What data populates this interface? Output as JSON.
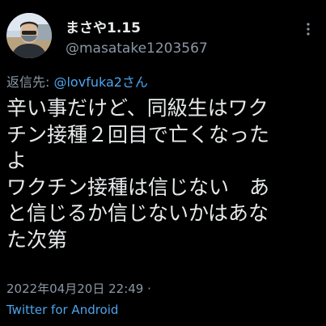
{
  "author": {
    "name": "まさや1.15",
    "handle": "@masatake1203567",
    "avatar": "avatar-photo"
  },
  "reply": {
    "label": "返信先: ",
    "target": "@lovfuka2さん"
  },
  "body": {
    "lines": [
      "辛い事だけど、同級生はワク",
      "チン接種２回目で亡くなった",
      "よ",
      "ワクチン接種は信じない　あ",
      "と信じるか信じないかはあな",
      "た次第"
    ]
  },
  "meta": {
    "timestamp": "2022年04月20日 22:49 ·",
    "client": "Twitter for Android"
  },
  "icons": {
    "more": "more-vertical-icon"
  },
  "colors": {
    "background": "#000000",
    "text": "#e7e9ea",
    "secondary": "#8b98a5",
    "link": "#4ea4ec"
  }
}
